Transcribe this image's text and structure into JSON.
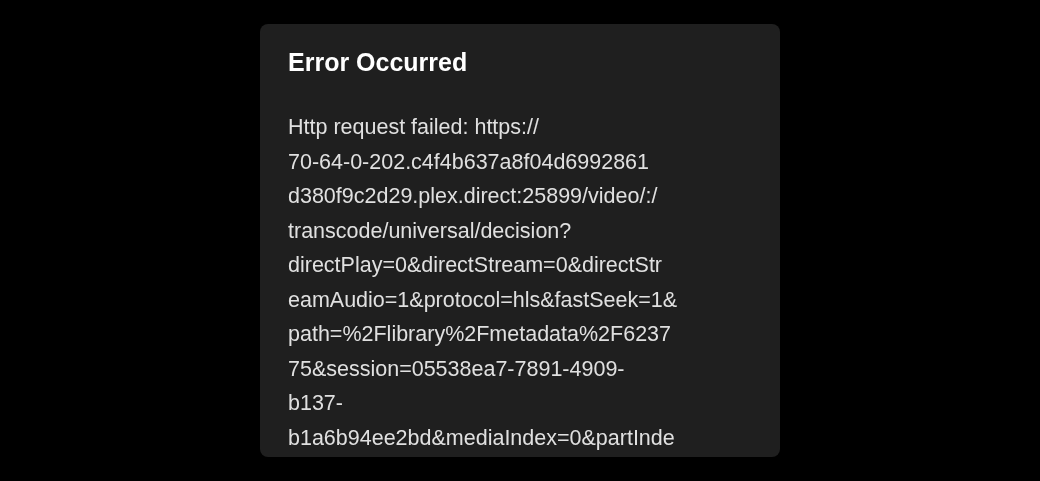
{
  "dialog": {
    "title": "Error Occurred",
    "message_lines": [
      "Http request failed: https://",
      "70-64-0-202.c4f4b637a8f04d6992861",
      "d380f9c2d29.plex.direct:25899/video/:/",
      "transcode/universal/decision?",
      "directPlay=0&directStream=0&directStr",
      "eamAudio=1&protocol=hls&fastSeek=1&",
      "path=%2Flibrary%2Fmetadata%2F6237",
      "75&session=05538ea7-7891-4909-",
      "b137-",
      "b1a6b94ee2bd&mediaIndex=0&partInde"
    ]
  }
}
